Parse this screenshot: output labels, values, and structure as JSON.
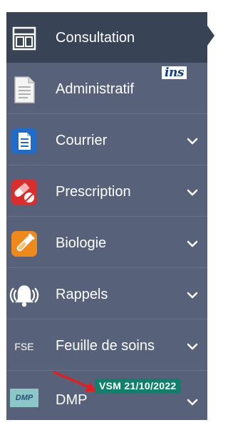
{
  "sidebar": {
    "items": [
      {
        "label": "Consultation",
        "icon": "consultation-layout-icon",
        "active": true
      },
      {
        "label": "Administratif",
        "icon": "document-icon",
        "badge": "ins"
      },
      {
        "label": "Courrier",
        "icon": "letter-icon"
      },
      {
        "label": "Prescription",
        "icon": "pills-icon"
      },
      {
        "label": "Biologie",
        "icon": "test-tube-icon"
      },
      {
        "label": "Rappels",
        "icon": "bell-icon"
      },
      {
        "label": "Feuille de soins",
        "icon": "fse-icon",
        "icon_text": "FSE"
      },
      {
        "label": "DMP",
        "icon": "dmp-icon",
        "icon_text": "DMP",
        "badge": "VSM 21/10/2022"
      }
    ]
  },
  "colors": {
    "sidebar_bg": "#57627a",
    "active_bg": "#394356",
    "vsm_badge": "#10806b",
    "annotation_arrow": "#e02020"
  }
}
